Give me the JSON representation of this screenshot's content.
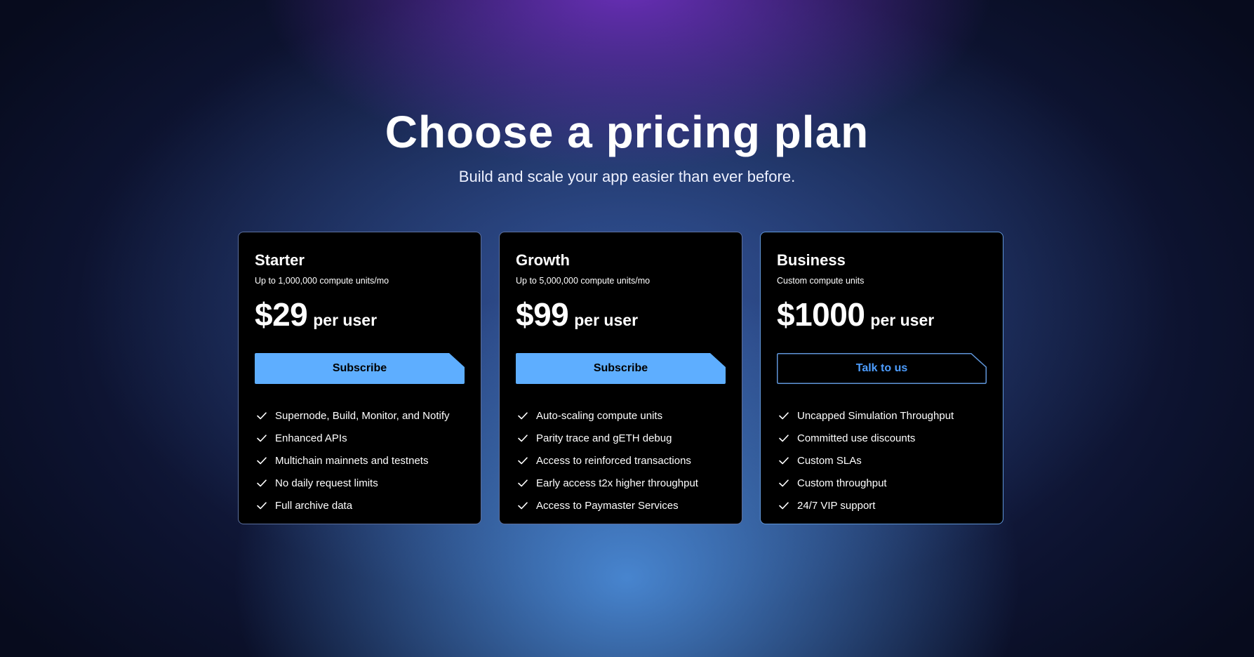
{
  "header": {
    "title": "Choose a pricing plan",
    "subtitle": "Build and scale your app easier than ever before."
  },
  "plans": [
    {
      "name": "Starter",
      "units": "Up to 1,000,000 compute units/mo",
      "price": "$29",
      "price_unit": "per user",
      "cta_label": "Subscribe",
      "cta_style": "filled",
      "features": [
        "Supernode, Build, Monitor, and Notify",
        "Enhanced APIs",
        "Multichain mainnets and testnets",
        "No daily request limits",
        "Full archive data"
      ]
    },
    {
      "name": "Growth",
      "units": "Up to 5,000,000 compute units/mo",
      "price": "$99",
      "price_unit": "per user",
      "cta_label": "Subscribe",
      "cta_style": "filled",
      "features": [
        "Auto-scaling compute units",
        "Parity trace and gETH debug",
        "Access to reinforced transactions",
        "Early access t2x higher throughput",
        "Access to Paymaster Services"
      ]
    },
    {
      "name": "Business",
      "units": "Custom compute units",
      "price": "$1000",
      "price_unit": "per user",
      "cta_label": "Talk to us",
      "cta_style": "outline",
      "features": [
        "Uncapped Simulation Throughput",
        "Committed use discounts",
        "Custom SLAs",
        "Custom throughput",
        "24/7 VIP support"
      ]
    }
  ],
  "icons": {
    "feature": "check-icon"
  },
  "colors": {
    "accent": "#5eaeff",
    "outline_text": "#4d9dff",
    "card_bg": "#000000"
  }
}
